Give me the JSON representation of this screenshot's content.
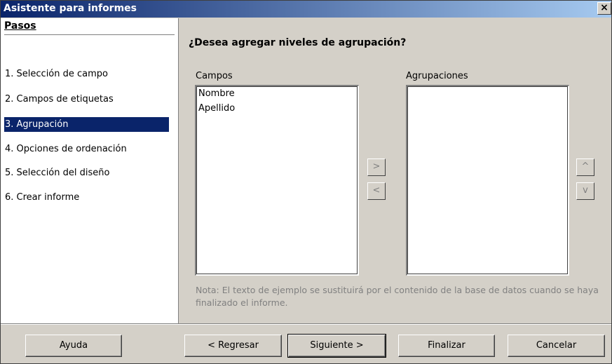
{
  "window": {
    "title": "Asistente para informes",
    "close_glyph": "×"
  },
  "sidebar": {
    "header": "Pasos",
    "steps": [
      {
        "label": "1.  Selección de campo"
      },
      {
        "label": "2.  Campos de etiquetas"
      },
      {
        "label": "3.  Agrupación"
      },
      {
        "label": "4.  Opciones de ordenación"
      },
      {
        "label": "5.  Selección del diseño"
      },
      {
        "label": "6.  Crear informe"
      }
    ]
  },
  "main": {
    "question": "¿Desea agregar niveles de agrupación?",
    "fields_label": "Campos",
    "groupings_label": "Agrupaciones",
    "fields": [
      "Nombre",
      "Apellido"
    ],
    "groupings": [],
    "add_glyph": ">",
    "remove_glyph": "<",
    "up_glyph": "^",
    "down_glyph": "v",
    "note": "Nota: El texto de ejemplo se sustituirá por el contenido de la base de datos cuando se haya finalizado el informe."
  },
  "buttons": {
    "help": "Ayuda",
    "back": "< Regresar",
    "next": "Siguiente >",
    "finish": "Finalizar",
    "cancel": "Cancelar"
  },
  "colors": {
    "title_start": "#0a246a",
    "title_end": "#a6caf0",
    "selection": "#0a246a",
    "face": "#d4d0c8"
  }
}
